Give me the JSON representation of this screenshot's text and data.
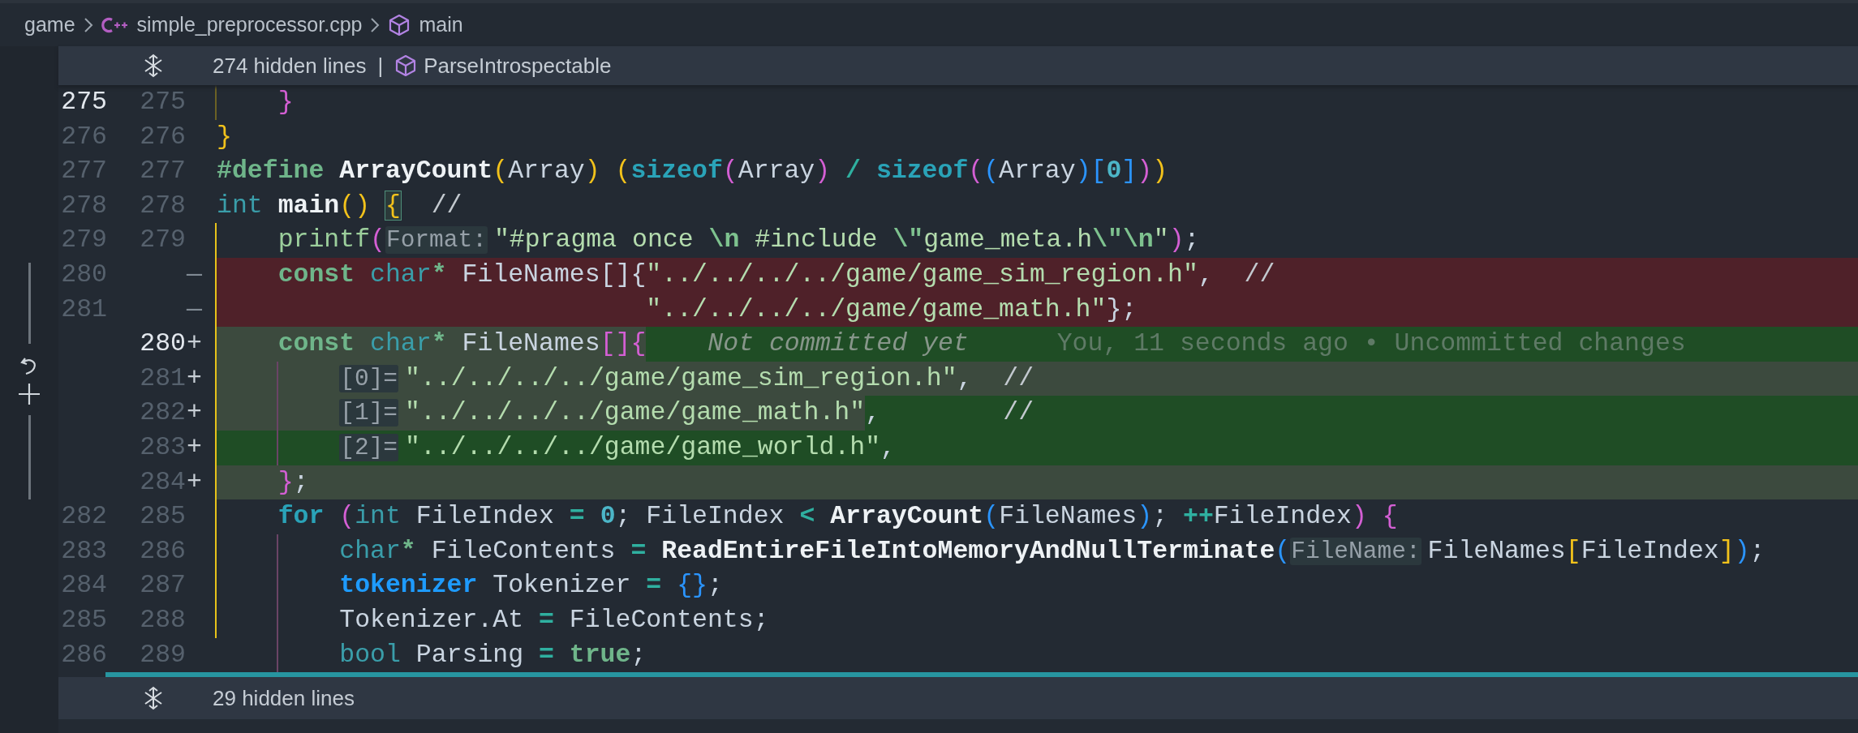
{
  "breadcrumb": [
    {
      "label": "game",
      "kind": "folder"
    },
    {
      "label": "simple_preprocessor.cpp",
      "kind": "file"
    },
    {
      "label": "main",
      "kind": "symbol"
    }
  ],
  "sticky": {
    "label": "274 hidden lines",
    "separator": "|",
    "symbol": "ParseIntrospectable"
  },
  "rows": [
    {
      "old": "275",
      "new": "275",
      "old_active": true,
      "kind": "context",
      "bracket_guide": true,
      "guide_focused": false,
      "inner_guide": false,
      "segments": [
        {
          "inserted": false,
          "tokens": [
            {
              "text": "    }",
              "kind": "b2"
            }
          ]
        }
      ]
    },
    {
      "old": "276",
      "new": "276",
      "kind": "context",
      "bracket_guide": false,
      "inner_guide": false,
      "segments": [
        {
          "inserted": false,
          "tokens": [
            {
              "text": "}",
              "kind": "b1"
            }
          ]
        }
      ]
    },
    {
      "old": "277",
      "new": "277",
      "kind": "context",
      "bracket_guide": false,
      "inner_guide": false,
      "segments": [
        {
          "inserted": false,
          "tokens": [
            {
              "text": "#define",
              "kind": "kw"
            },
            {
              "text": " ArrayCount",
              "kind": "fn"
            },
            {
              "text": "(",
              "kind": "b1"
            },
            {
              "text": "Array",
              "kind": "id"
            },
            {
              "text": ")",
              "kind": "b1"
            },
            {
              "text": " (",
              "kind": "b1"
            },
            {
              "text": "sizeof",
              "kind": "kw2"
            },
            {
              "text": "(",
              "kind": "b2"
            },
            {
              "text": "Array",
              "kind": "id"
            },
            {
              "text": ")",
              "kind": "b2"
            },
            {
              "text": " /",
              "kind": "op"
            },
            {
              "text": " sizeof",
              "kind": "kw2"
            },
            {
              "text": "(",
              "kind": "b2"
            },
            {
              "text": "(",
              "kind": "b3"
            },
            {
              "text": "Array",
              "kind": "id"
            },
            {
              "text": ")",
              "kind": "b3"
            },
            {
              "text": "[",
              "kind": "b3"
            },
            {
              "text": "0",
              "kind": "num"
            },
            {
              "text": "]",
              "kind": "b3"
            },
            {
              "text": ")",
              "kind": "b2"
            },
            {
              "text": ")",
              "kind": "b1"
            }
          ]
        }
      ]
    },
    {
      "old": "278",
      "new": "278",
      "kind": "context",
      "bracket_guide": false,
      "inner_guide": false,
      "segments": [
        {
          "inserted": false,
          "tokens": [
            {
              "text": "int",
              "kind": "type"
            },
            {
              "text": " main",
              "kind": "fn"
            },
            {
              "text": "()",
              "kind": "b1"
            },
            {
              "text": " {",
              "kind": "b1match"
            },
            {
              "text": "  //",
              "kind": "cmt"
            }
          ]
        }
      ]
    },
    {
      "old": "279",
      "new": "279",
      "kind": "context",
      "bracket_guide": true,
      "guide_focused": true,
      "inner_guide": false,
      "segments": [
        {
          "inserted": false,
          "tokens": [
            {
              "text": "    printf",
              "kind": "call"
            },
            {
              "text": "(",
              "kind": "b2"
            },
            {
              "text": "Format:",
              "kind": "hint"
            },
            {
              "text": "\"#pragma once ",
              "kind": "str"
            },
            {
              "text": "\\n",
              "kind": "esc"
            },
            {
              "text": " #include ",
              "kind": "str"
            },
            {
              "text": "\\\"",
              "kind": "esc"
            },
            {
              "text": "game_meta.h",
              "kind": "str"
            },
            {
              "text": "\\\"\\n",
              "kind": "esc"
            },
            {
              "text": "\"",
              "kind": "str"
            },
            {
              "text": ")",
              "kind": "b2"
            },
            {
              "text": ";",
              "kind": "punct"
            }
          ]
        }
      ]
    },
    {
      "old": "280",
      "sign": "—",
      "kind": "deleted",
      "bracket_guide": true,
      "guide_focused": true,
      "inner_guide": false,
      "segments": [
        {
          "inserted": false,
          "tokens": [
            {
              "text": "    const",
              "kind": "kw"
            },
            {
              "text": " char",
              "kind": "type"
            },
            {
              "text": "*",
              "kind": "kw"
            },
            {
              "text": " FileNames",
              "kind": "id"
            },
            {
              "text": "[]{",
              "kind": "punct"
            },
            {
              "text": "\"../../../../game/game_sim_region.h\"",
              "kind": "str"
            },
            {
              "text": ",",
              "kind": "punct"
            },
            {
              "text": "  //",
              "kind": "cmt"
            }
          ]
        }
      ]
    },
    {
      "old": "281",
      "sign": "—",
      "kind": "deleted",
      "bracket_guide": true,
      "guide_focused": true,
      "inner_guide": false,
      "segments": [
        {
          "inserted": false,
          "tokens": [
            {
              "text": "                            \"../../../../game/game_math.h\"",
              "kind": "str"
            },
            {
              "text": "};",
              "kind": "punct"
            }
          ]
        }
      ]
    },
    {
      "new": "280",
      "sign": "+",
      "new_active": true,
      "kind": "added",
      "bracket_guide": true,
      "guide_focused": true,
      "inner_guide": false,
      "tail_inserted": true,
      "segments": [
        {
          "inserted": false,
          "tokens": [
            {
              "text": "    const",
              "kind": "kw"
            },
            {
              "text": " char",
              "kind": "type"
            },
            {
              "text": "*",
              "kind": "kw"
            },
            {
              "text": " FileNames",
              "kind": "id"
            },
            {
              "text": "[]{",
              "kind": "b2"
            }
          ]
        }
      ],
      "blame": {
        "hint": "Not committed yet",
        "text": "You, 11 seconds ago • Uncommitted changes"
      }
    },
    {
      "new": "281",
      "sign": "+",
      "kind": "added",
      "bracket_guide": true,
      "guide_focused": true,
      "inner_guide": true,
      "tail_inserted": false,
      "segments": [
        {
          "inserted": false,
          "tokens": [
            {
              "text": "        [0]=",
              "kind": "hint"
            },
            {
              "text": "\"../../../../game/game_sim_region.h\"",
              "kind": "str"
            },
            {
              "text": ",",
              "kind": "punct"
            },
            {
              "text": "  //",
              "kind": "cmt"
            }
          ]
        }
      ]
    },
    {
      "new": "282",
      "sign": "+",
      "kind": "added",
      "bracket_guide": true,
      "guide_focused": true,
      "inner_guide": true,
      "tail_inserted": true,
      "segments": [
        {
          "inserted": false,
          "tokens": [
            {
              "text": "        [1]=",
              "kind": "hint"
            },
            {
              "text": "\"../../../../game/game_math.h\"",
              "kind": "str"
            }
          ]
        },
        {
          "inserted": true,
          "tokens": [
            {
              "text": ",",
              "kind": "punct"
            },
            {
              "text": "        //",
              "kind": "cmt"
            }
          ]
        }
      ]
    },
    {
      "new": "283",
      "sign": "+",
      "kind": "added",
      "bracket_guide": true,
      "guide_focused": true,
      "inner_guide": true,
      "tail_inserted": true,
      "segments": [
        {
          "inserted": true,
          "tokens": [
            {
              "text": "        [2]=",
              "kind": "hint"
            },
            {
              "text": "\"../../../../game/game_world.h\"",
              "kind": "str"
            },
            {
              "text": ",",
              "kind": "punct"
            }
          ]
        }
      ]
    },
    {
      "new": "284",
      "sign": "+",
      "kind": "added",
      "bracket_guide": true,
      "guide_focused": true,
      "inner_guide": false,
      "tail_inserted": false,
      "segments": [
        {
          "inserted": false,
          "tokens": [
            {
              "text": "    }",
              "kind": "b2"
            },
            {
              "text": ";",
              "kind": "punct"
            }
          ]
        }
      ]
    },
    {
      "old": "282",
      "new": "285",
      "kind": "context",
      "bracket_guide": true,
      "guide_focused": true,
      "inner_guide": false,
      "segments": [
        {
          "inserted": false,
          "tokens": [
            {
              "text": "    for",
              "kind": "kw2"
            },
            {
              "text": " (",
              "kind": "b2"
            },
            {
              "text": "int",
              "kind": "type"
            },
            {
              "text": " FileIndex ",
              "kind": "id"
            },
            {
              "text": "=",
              "kind": "op"
            },
            {
              "text": " 0",
              "kind": "num"
            },
            {
              "text": ";",
              "kind": "punct"
            },
            {
              "text": " FileIndex ",
              "kind": "id"
            },
            {
              "text": "<",
              "kind": "op"
            },
            {
              "text": " ArrayCount",
              "kind": "fn"
            },
            {
              "text": "(",
              "kind": "b3"
            },
            {
              "text": "FileNames",
              "kind": "id"
            },
            {
              "text": ")",
              "kind": "b3"
            },
            {
              "text": ";",
              "kind": "punct"
            },
            {
              "text": " ++",
              "kind": "op"
            },
            {
              "text": "FileIndex",
              "kind": "id"
            },
            {
              "text": ")",
              "kind": "b2"
            },
            {
              "text": " {",
              "kind": "b2"
            }
          ]
        }
      ]
    },
    {
      "old": "283",
      "new": "286",
      "kind": "context",
      "bracket_guide": true,
      "guide_focused": true,
      "inner_guide": true,
      "segments": [
        {
          "inserted": false,
          "tokens": [
            {
              "text": "        char",
              "kind": "type"
            },
            {
              "text": "*",
              "kind": "kw"
            },
            {
              "text": " FileContents ",
              "kind": "id"
            },
            {
              "text": "=",
              "kind": "op"
            },
            {
              "text": " ReadEntireFileIntoMemoryAndNullTerminate",
              "kind": "fn"
            },
            {
              "text": "(",
              "kind": "b3"
            },
            {
              "text": "FileName:",
              "kind": "hint"
            },
            {
              "text": "FileNames",
              "kind": "id"
            },
            {
              "text": "[",
              "kind": "b1"
            },
            {
              "text": "FileIndex",
              "kind": "id"
            },
            {
              "text": "]",
              "kind": "b1"
            },
            {
              "text": ")",
              "kind": "b3"
            },
            {
              "text": ";",
              "kind": "punct"
            }
          ]
        }
      ]
    },
    {
      "old": "284",
      "new": "287",
      "kind": "context",
      "bracket_guide": true,
      "guide_focused": true,
      "inner_guide": true,
      "segments": [
        {
          "inserted": false,
          "tokens": [
            {
              "text": "        tokenizer",
              "kind": "tkn"
            },
            {
              "text": " Tokenizer ",
              "kind": "id"
            },
            {
              "text": "=",
              "kind": "op"
            },
            {
              "text": " {}",
              "kind": "b3"
            },
            {
              "text": ";",
              "kind": "punct"
            }
          ]
        }
      ]
    },
    {
      "old": "285",
      "new": "288",
      "kind": "context",
      "bracket_guide": true,
      "guide_focused": true,
      "inner_guide": true,
      "segments": [
        {
          "inserted": false,
          "tokens": [
            {
              "text": "        Tokenizer.At ",
              "kind": "id"
            },
            {
              "text": "=",
              "kind": "op"
            },
            {
              "text": " FileContents",
              "kind": "id"
            },
            {
              "text": ";",
              "kind": "punct"
            }
          ]
        }
      ]
    },
    {
      "old": "286",
      "new": "289",
      "kind": "context",
      "bracket_guide": false,
      "inner_guide": true,
      "segments": [
        {
          "inserted": false,
          "tokens": [
            {
              "text": "        bool",
              "kind": "type"
            },
            {
              "text": " Parsing ",
              "kind": "id"
            },
            {
              "text": "=",
              "kind": "op"
            },
            {
              "text": " true",
              "kind": "kw"
            },
            {
              "text": ";",
              "kind": "punct"
            }
          ]
        }
      ]
    }
  ],
  "bottom_fold": {
    "label": "29 hidden lines"
  }
}
